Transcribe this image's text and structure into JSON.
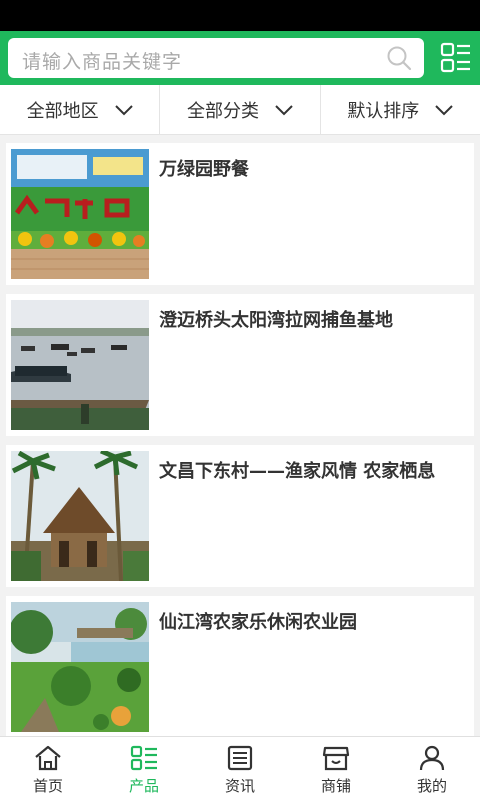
{
  "search": {
    "placeholder": "请输入商品关键字"
  },
  "filters": [
    {
      "label": "全部地区"
    },
    {
      "label": "全部分类"
    },
    {
      "label": "默认排序"
    }
  ],
  "products": [
    {
      "title": "万绿园野餐",
      "image": "park-garden-photo"
    },
    {
      "title": "澄迈桥头太阳湾拉网捕鱼基地",
      "image": "fishing-bay-photo"
    },
    {
      "title": "文昌下东村——渔家风情 农家栖息",
      "image": "coconut-village-photo"
    },
    {
      "title": "仙江湾农家乐休闲农业园",
      "image": "farm-garden-photo"
    }
  ],
  "tabs": [
    {
      "label": "首页",
      "icon": "home-icon"
    },
    {
      "label": "产品",
      "icon": "list-icon"
    },
    {
      "label": "资讯",
      "icon": "news-icon"
    },
    {
      "label": "商铺",
      "icon": "store-icon"
    },
    {
      "label": "我的",
      "icon": "user-icon"
    }
  ],
  "colors": {
    "brand": "#1fb85c",
    "text": "#333333",
    "placeholder": "#a9a9a9"
  },
  "active_tab": "产品"
}
